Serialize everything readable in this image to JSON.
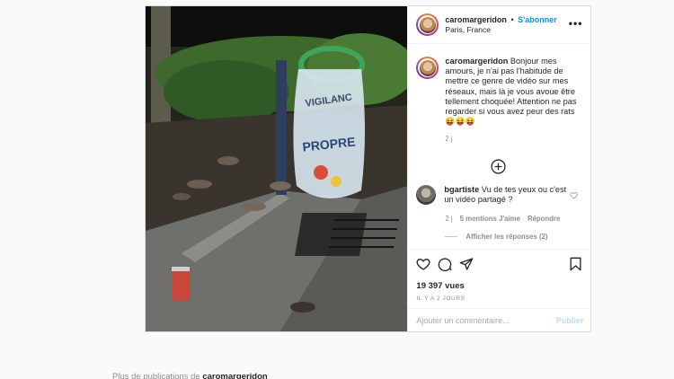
{
  "post": {
    "username": "caromargeridon",
    "separator": "•",
    "follow_label": "S'abonner",
    "location": "Paris, France",
    "more_label": "•••",
    "caption_username": "caromargeridon",
    "caption_text": "Bonjour mes amours, je n'ai pas l'habitude de mettre ce genre de vidéo sur mes réseaux, mais là je vous avoue être tellement choquée! Attention ne pas regarder si vous avez peur des rats",
    "caption_emoji": "😝😝😝",
    "caption_time": "2 j"
  },
  "media": {
    "bag_text_1": "VIGILANC",
    "bag_text_2": "PROPRE"
  },
  "comment": {
    "username": "bgartiste",
    "text": "Vu de tes yeux ou c'est un vidéo partagé ?",
    "time": "2 j",
    "likes": "5 mentions J'aime",
    "reply_label": "Répondre",
    "show_replies": "Afficher les réponses (2)"
  },
  "actions": {
    "views": "19 397 vues",
    "time_ago": "IL Y A 2 JOURS",
    "comment_placeholder": "Ajouter un commentaire...",
    "publish_label": "Publier"
  },
  "footer": {
    "more_prefix": "Plus de publications de",
    "more_user": "caromargeridon"
  },
  "colors": {
    "accent": "#0095f6",
    "publish_disabled": "#b2dffc",
    "muted": "#8e8e8e",
    "bag_green": "#3fa55a"
  }
}
